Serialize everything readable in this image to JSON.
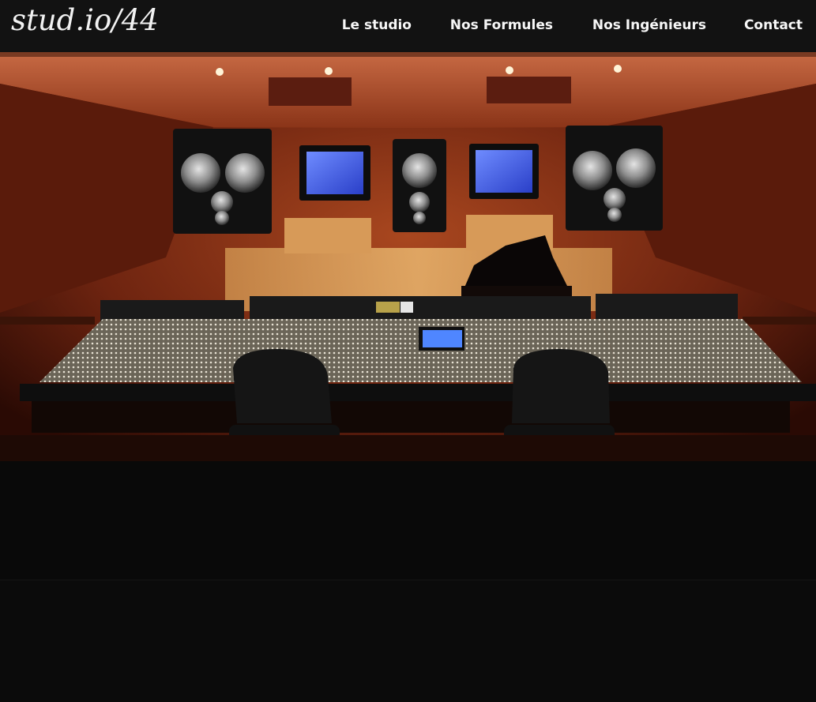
{
  "header": {
    "logo_text": "stud.io/44",
    "nav": [
      {
        "label": "Le studio"
      },
      {
        "label": "Nos Formules"
      },
      {
        "label": "Nos Ingénieurs"
      },
      {
        "label": "Contact"
      }
    ]
  },
  "hero": {
    "image": "recording-studio-control-room-photo"
  },
  "colors": {
    "header_bg": "#121212",
    "page_bg": "#0a0a0a",
    "nav_text": "#f7f7f7"
  }
}
